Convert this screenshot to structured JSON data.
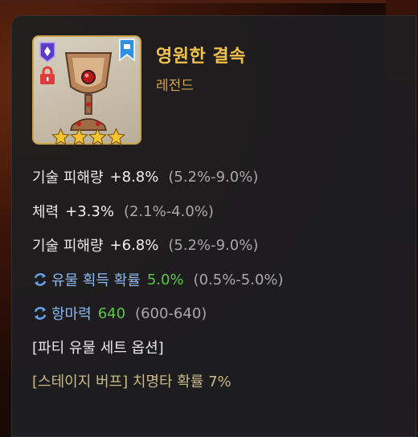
{
  "item": {
    "name": "영원한 결속",
    "rarity": "레전드",
    "stars": 4,
    "colors": {
      "name": "#f2c24b",
      "rarity": "#d4a24a",
      "frame": "#c9a24a"
    }
  },
  "stats": [
    {
      "label": "기술 피해량",
      "value": "+8.8%",
      "range": "(5.2%-9.0%)"
    },
    {
      "label": "체력",
      "value": "+3.3%",
      "range": "(2.1%-4.0%)"
    },
    {
      "label": "기술 피해량",
      "value": "+6.8%",
      "range": "(5.2%-9.0%)"
    }
  ],
  "reroll_stats": [
    {
      "label": "유물 획득 확률",
      "value": "5.0%",
      "range": "(0.5%-5.0%)"
    },
    {
      "label": "항마력",
      "value": "640",
      "range": "(600-640)"
    }
  ],
  "set": {
    "title": "[파티 유물 세트 옵션]",
    "effect": "[스테이지 버프] 치명타 확률 7%"
  },
  "icons": {
    "grade": "diamond-grade-icon",
    "lock": "lock-icon",
    "bookmark": "bookmark-icon",
    "reroll": "reroll-cycle-icon",
    "star": "star-icon"
  }
}
